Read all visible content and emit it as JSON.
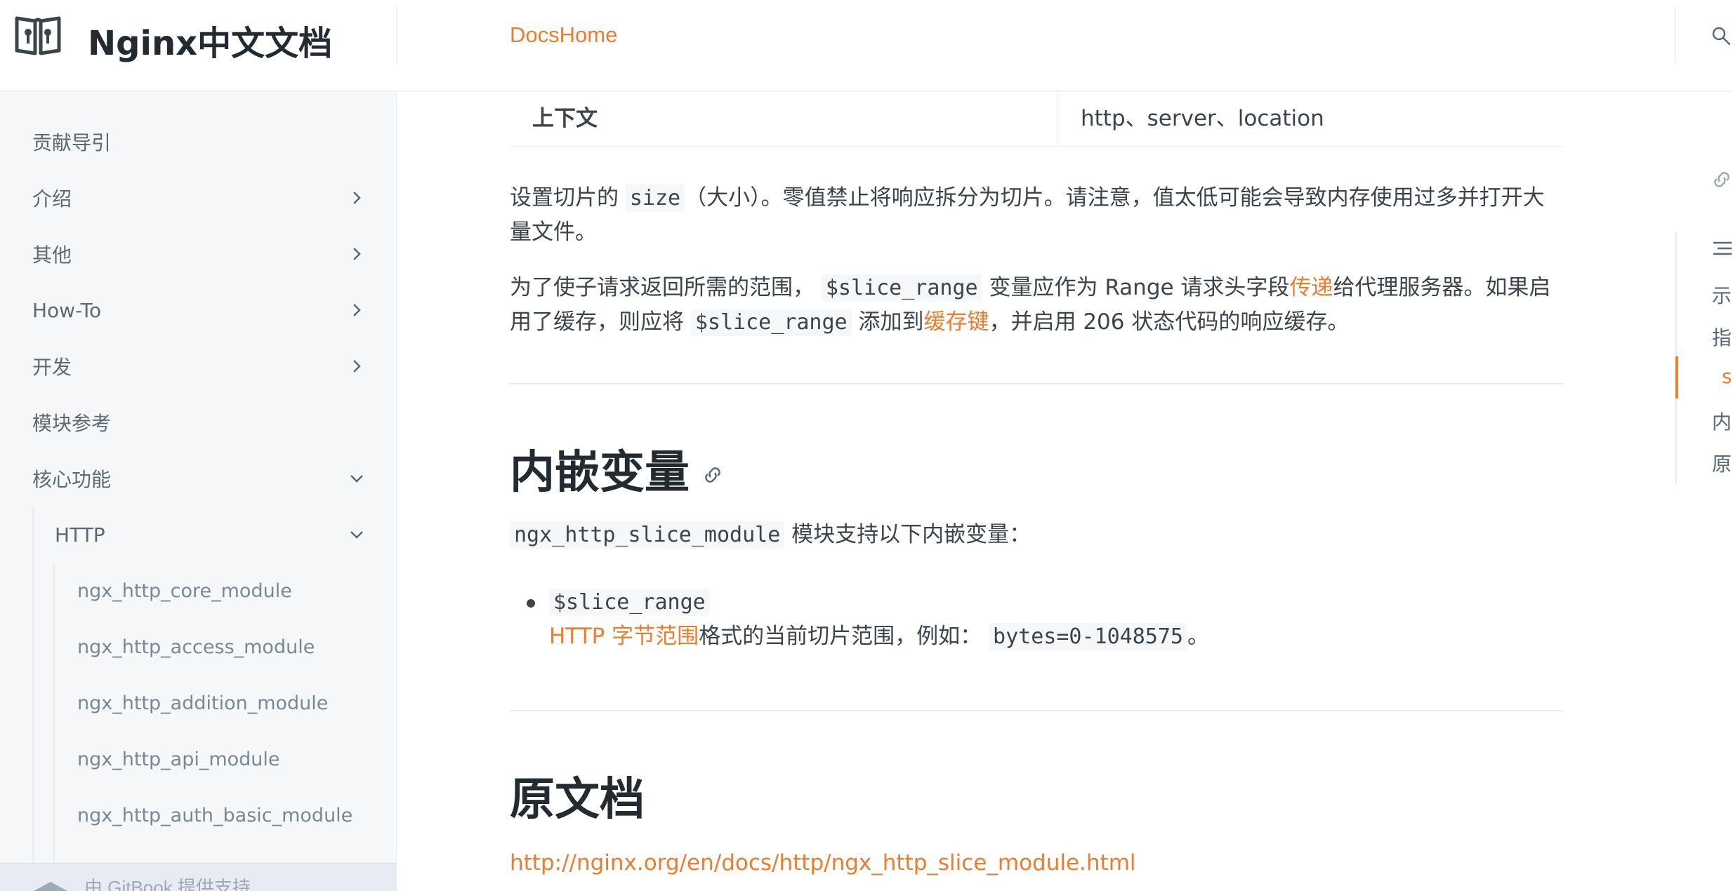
{
  "header": {
    "site_title": "Nginx中文文档",
    "home_link": "DocsHome"
  },
  "sidebar": {
    "items": [
      {
        "label": "贡献导引"
      },
      {
        "label": "介绍"
      },
      {
        "label": "其他"
      },
      {
        "label": "How-To"
      },
      {
        "label": "开发"
      },
      {
        "label": "模块参考"
      },
      {
        "label": "核心功能"
      },
      {
        "label": "HTTP"
      },
      {
        "label": "ngx_http_core_module"
      },
      {
        "label": "ngx_http_access_module"
      },
      {
        "label": "ngx_http_addition_module"
      },
      {
        "label": "ngx_http_api_module"
      },
      {
        "label": "ngx_http_auth_basic_module"
      }
    ],
    "footer_text": "由 GitBook 提供支持"
  },
  "content": {
    "table_row": {
      "key": "上下文",
      "value": "http、server、location"
    },
    "para1": {
      "t1": "设置切片的 ",
      "c1": "size",
      "t2": "（大小）。零值禁止将响应拆分为切片。请注意，值太低可能会导致内存使用过多并打开大量文件。"
    },
    "para2": {
      "t1": "为了使子请求返回所需的范围， ",
      "c1": "$slice_range",
      "t2": " 变量应作为 Range 请求头字段",
      "l1": "传递",
      "t3": "给代理服务器。如果启用了缓存，则应将 ",
      "c2": "$slice_range",
      "t4": " 添加到",
      "l2": "缓存键",
      "t5": "，并启用 206 状态代码的响应缓存。"
    },
    "h_vars": "内嵌变量",
    "para3": {
      "c1": "ngx_http_slice_module",
      "t1": " 模块支持以下内嵌变量："
    },
    "var_item": {
      "name": "$slice_range",
      "l1": "HTTP 字节范围",
      "t1": "格式的当前切片范围，例如： ",
      "c1": "bytes=0-1048575",
      "t2": "。"
    },
    "h_orig": "原文档",
    "orig_link": "http://nginx.org/en/docs/http/ngx_http_slice_module.html"
  },
  "toc": {
    "items": [
      "示",
      "指",
      "s",
      "内",
      "原"
    ]
  },
  "colors": {
    "accent": "#ef7b2c",
    "text": "#3b434b",
    "sidebar_bg": "#f5f7f9"
  }
}
